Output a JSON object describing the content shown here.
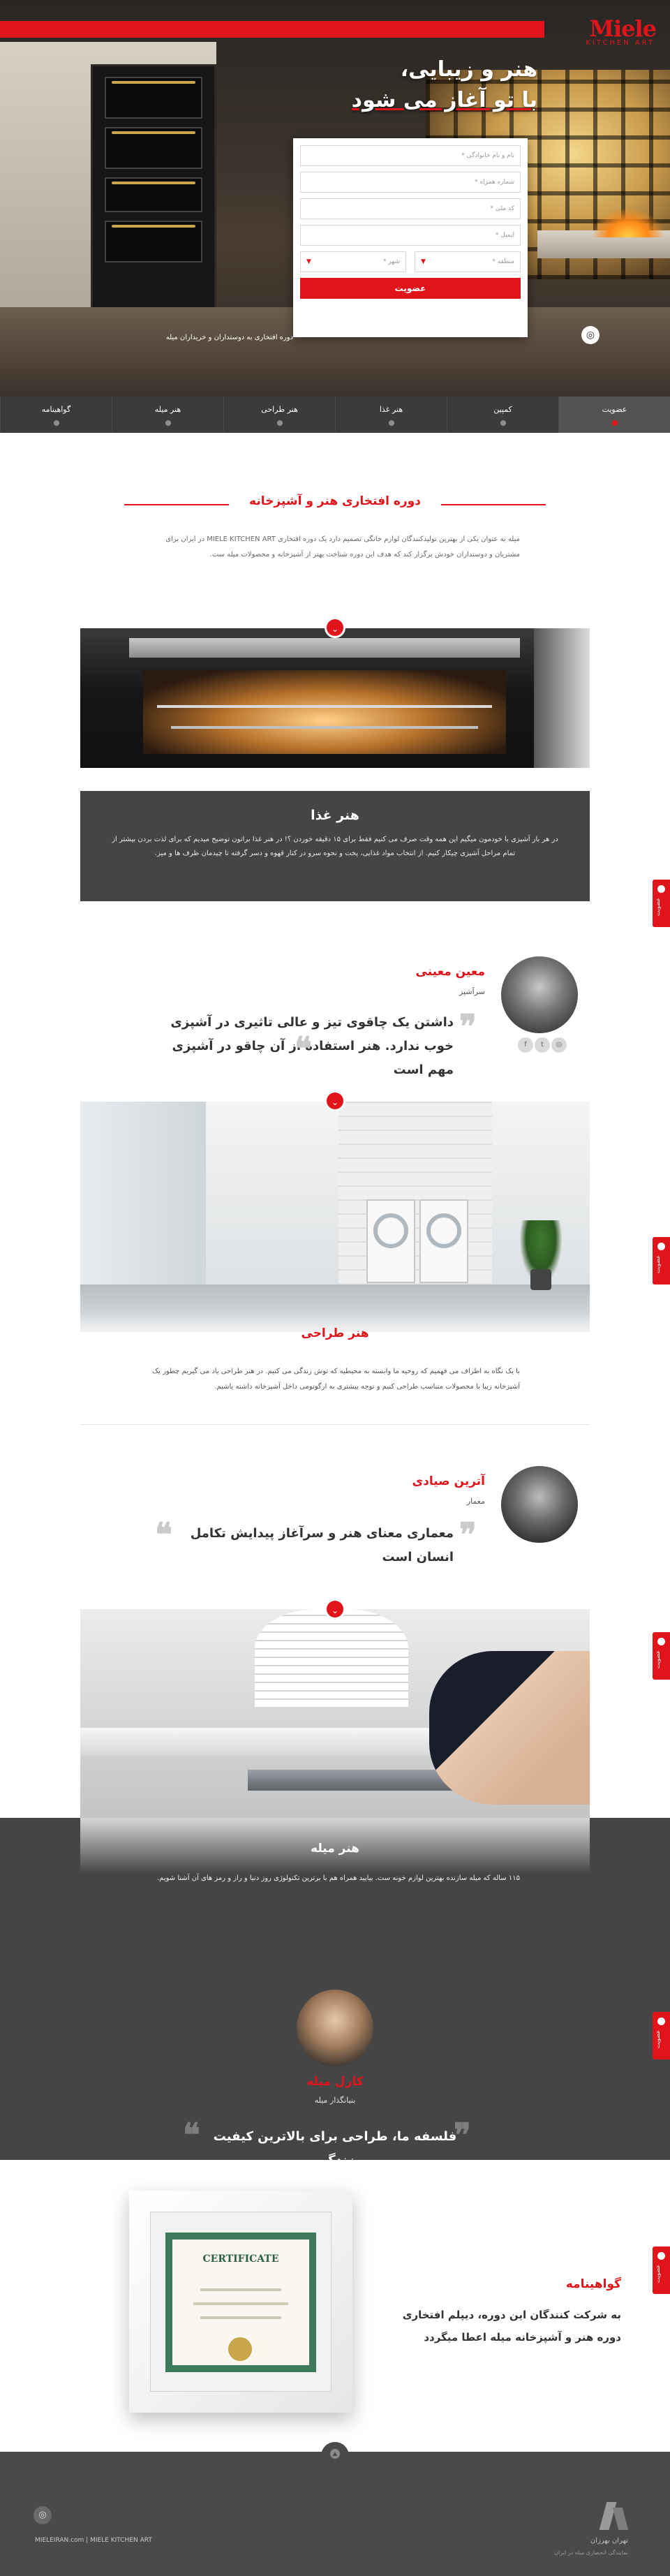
{
  "brand": {
    "logo_word": "Miele",
    "logo_sub": "KITCHEN ART",
    "accent_color": "#e2141b",
    "dark_color": "#454545"
  },
  "hero": {
    "title_line1": "هنر و زیبایی،",
    "title_line2": "با تو آغاز می شود",
    "caption": "دوره افتخاری به دوستداران و خریداران میله",
    "form": {
      "field_1_placeholder": "نام و نام خانوادگی *",
      "field_2_placeholder": "شماره همراه *",
      "field_3_placeholder": "کد ملی *",
      "field_4_placeholder": "ایمیل *",
      "select_city": "شهر *",
      "select_area": "منطقه *",
      "submit_label": "عضویت"
    },
    "instagram_icon": "instagram-icon"
  },
  "nav": {
    "items": [
      {
        "label": "عضویت"
      },
      {
        "label": "کمپین"
      },
      {
        "label": "هنر غذا"
      },
      {
        "label": "هنر طراحی"
      },
      {
        "label": "هنر میله"
      },
      {
        "label": "گواهینامه"
      }
    ]
  },
  "intro": {
    "heading": "دوره افتخاری هنر و آشپزخانه",
    "paragraph": "میله به عنوان یکی از بهترین تولیدکنندگان لوازم خانگی تصمیم دارد یک دوره افتخاری MIELE KITCHEN ART در ایران برای مشتریان و دوستداران خودش برگزار کند که هدف این دوره شناخت بهتر از آشپزخانه و محصولات میله ست."
  },
  "food": {
    "heading": "هنر غذا",
    "paragraph": "در هر بار آشپزی با خودمون میگیم این همه وقت صرف می کنیم فقط برای ۱۵ دقیقه خوردن ؟! در هنر غذا براتون توضیح میدیم که برای لذت بردن بیشتر از تمام مراحل آشپزی چیکار کنیم. از انتخاب مواد غذایی، پخت و نحوه سرو در کنار قهوه و دسر گرفته تا چیدمان ظرف ها و میز."
  },
  "quote1": {
    "name": "معین معینی",
    "role": "سرآشپز",
    "text": "داشتن یک چاقوی تیز و عالی تاثیری در آشپزی خوب ندارد. هنر استفاده از آن چاقو در آشپزی مهم است"
  },
  "design": {
    "heading": "هنر طراحی",
    "paragraph": "با یک نگاه به اطراف می فهمیم که روحیه ما وابسته به محیطیه که توش زندگی می کنیم. در هنر طراحی یاد می گیریم چطور یک آشپزخانه زیبا با محصولات متناسب طراحی کنیم و توجه بیشتری به ارگونومی داخل آشپزخانه داشته باشیم."
  },
  "quote2": {
    "name": "آترین صیادی",
    "role": "معمار",
    "text": "معماری معنای هنر و سرآغاز پیدایش تکامل انسان است"
  },
  "miele": {
    "heading": "هنر میله",
    "paragraph": "۱۱۵ ساله که میله سازنده بهترین لوازم خونه ست. بیایید همراه هم با برترین تکنولوژی روز دنیا و راز و رمز های آن آشنا شویم."
  },
  "quote3": {
    "name": "کارل میله",
    "role": "بنیانگذار میله",
    "text": "فلسفه ما، طراحی برای بالاترین کیفیت زندگی"
  },
  "certificate": {
    "heading": "گواهینامه",
    "text": "به شرکت کنندگان این دوره، دیپلم افتخاری دوره هنر و آشپزخانه میله اعطا میگردد",
    "doc_word": "CERTIFICATE"
  },
  "side_tab_label": "عضویت",
  "footer": {
    "links": "MIELEIRAN.com  |  MIELE KITCHEN ART",
    "company": "تهران بهرزان",
    "company_sub": "نمایندگی انحصاری میله در ایران"
  }
}
